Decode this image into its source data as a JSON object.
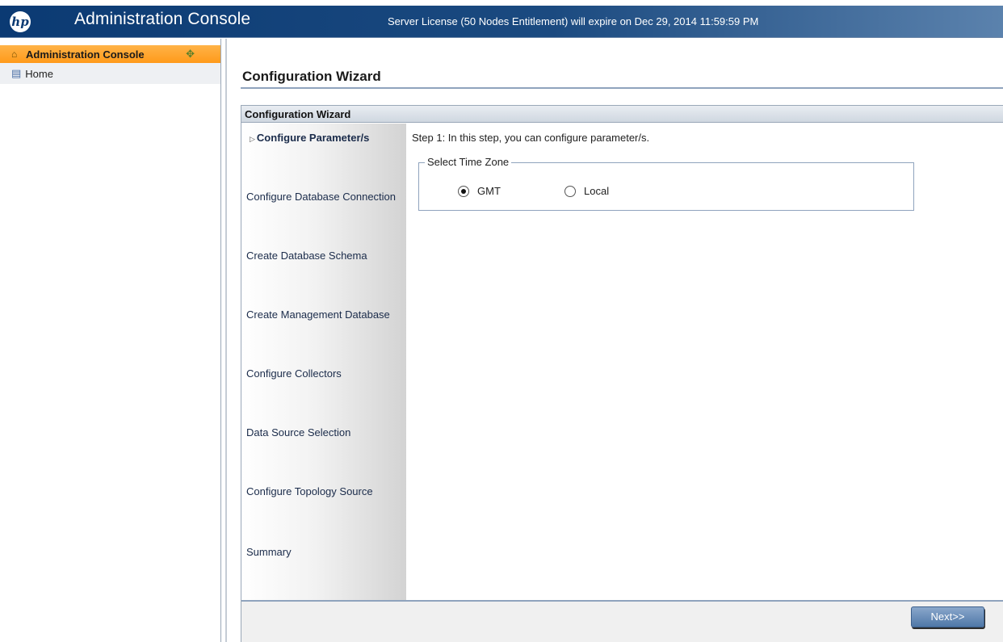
{
  "header": {
    "logo_text": "hp",
    "app_title": "Administration Console",
    "license_message": "Server License (50 Nodes Entitlement) will expire on Dec 29, 2014 11:59:59 PM"
  },
  "sidebar": {
    "section_label": "Administration Console",
    "items": [
      {
        "label": "Home",
        "icon": "page-icon"
      }
    ]
  },
  "page": {
    "title": "Configuration Wizard"
  },
  "wizard": {
    "panel_title": "Configuration Wizard",
    "steps": [
      {
        "label": "Configure Parameter/s",
        "active": true
      },
      {
        "label": "Configure Database Connection",
        "active": false
      },
      {
        "label": "Create Database Schema",
        "active": false
      },
      {
        "label": "Create Management Database",
        "active": false
      },
      {
        "label": "Configure Collectors",
        "active": false
      },
      {
        "label": "Data Source Selection",
        "active": false
      },
      {
        "label": "Configure Topology Source",
        "active": false
      },
      {
        "label": "Summary",
        "active": false
      }
    ],
    "step_description": "Step 1: In this step, you can configure parameter/s.",
    "time_zone": {
      "legend": "Select Time Zone",
      "options": [
        {
          "label": "GMT",
          "selected": true
        },
        {
          "label": "Local",
          "selected": false
        }
      ]
    },
    "next_label": "Next>>"
  },
  "colors": {
    "header_bg": "#0b3a73",
    "sidebar_active": "#ff9a1a",
    "rule": "#8fa3bd"
  }
}
